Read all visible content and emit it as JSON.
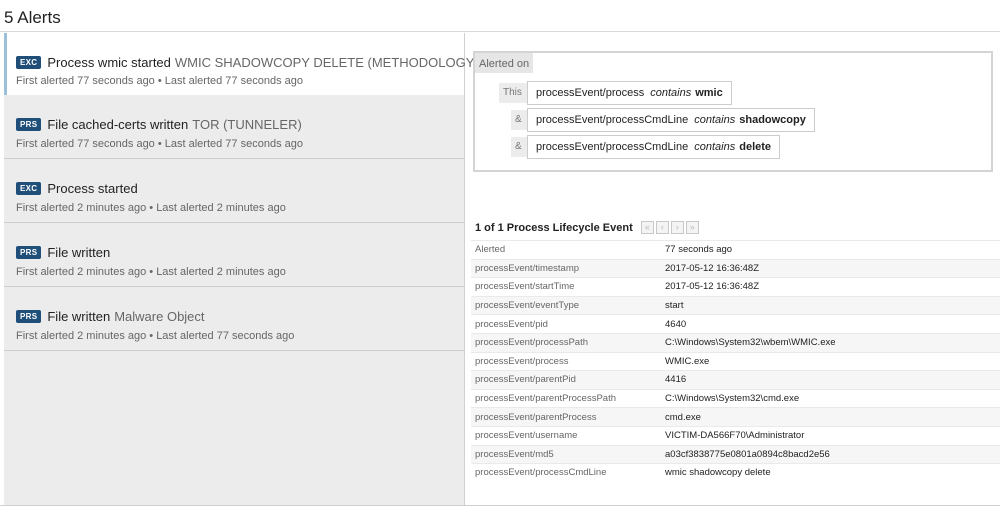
{
  "header": {
    "title": "5 Alerts"
  },
  "alerts": [
    {
      "badge": "EXC",
      "name": "Process wmic started",
      "detail": "WMIC SHADOWCOPY DELETE (METHODOLOGY)",
      "times": "First alerted 77 seconds ago • Last alerted 77 seconds ago"
    },
    {
      "badge": "PRS",
      "name": "File cached-certs written",
      "detail": "TOR (TUNNELER)",
      "times": "First alerted 77 seconds ago • Last alerted 77 seconds ago"
    },
    {
      "badge": "EXC",
      "name": "Process started",
      "detail": "",
      "times": "First alerted 2 minutes ago • Last alerted 2 minutes ago"
    },
    {
      "badge": "PRS",
      "name": "File written",
      "detail": "",
      "times": "First alerted 2 minutes ago • Last alerted 2 minutes ago"
    },
    {
      "badge": "PRS",
      "name": "File written",
      "detail": "Malware Object",
      "times": "First alerted 2 minutes ago • Last alerted 77 seconds ago"
    }
  ],
  "alerted_on": {
    "tab_label": "Alerted on",
    "conditions": [
      {
        "label": "This",
        "field": "processEvent/process",
        "op": "contains",
        "value": "wmic"
      },
      {
        "label": "&",
        "field": "processEvent/processCmdLine",
        "op": "contains",
        "value": "shadowcopy"
      },
      {
        "label": "&",
        "field": "processEvent/processCmdLine",
        "op": "contains",
        "value": "delete"
      }
    ]
  },
  "event": {
    "title": "1 of 1 Process Lifecycle Event",
    "pager": [
      "«",
      "‹",
      "›",
      "»"
    ],
    "rows": [
      {
        "key": "Alerted",
        "value": "77 seconds ago"
      },
      {
        "key": "processEvent/timestamp",
        "value": "2017-05-12 16:36:48Z"
      },
      {
        "key": "processEvent/startTime",
        "value": "2017-05-12 16:36:48Z"
      },
      {
        "key": "processEvent/eventType",
        "value": "start"
      },
      {
        "key": "processEvent/pid",
        "value": "4640"
      },
      {
        "key": "processEvent/processPath",
        "value": "C:\\Windows\\System32\\wbem\\WMIC.exe"
      },
      {
        "key": "processEvent/process",
        "value": "WMIC.exe"
      },
      {
        "key": "processEvent/parentPid",
        "value": "4416"
      },
      {
        "key": "processEvent/parentProcessPath",
        "value": "C:\\Windows\\System32\\cmd.exe"
      },
      {
        "key": "processEvent/parentProcess",
        "value": "cmd.exe"
      },
      {
        "key": "processEvent/username",
        "value": "VICTIM-DA566F70\\Administrator"
      },
      {
        "key": "processEvent/md5",
        "value": "a03cf3838775e0801a0894c8bacd2e56"
      },
      {
        "key": "processEvent/processCmdLine",
        "value": "wmic shadowcopy delete"
      }
    ]
  },
  "colors": {
    "badge": "#1f4e79",
    "selected_accent": "#9dc0da",
    "list_bg": "#ececec"
  }
}
